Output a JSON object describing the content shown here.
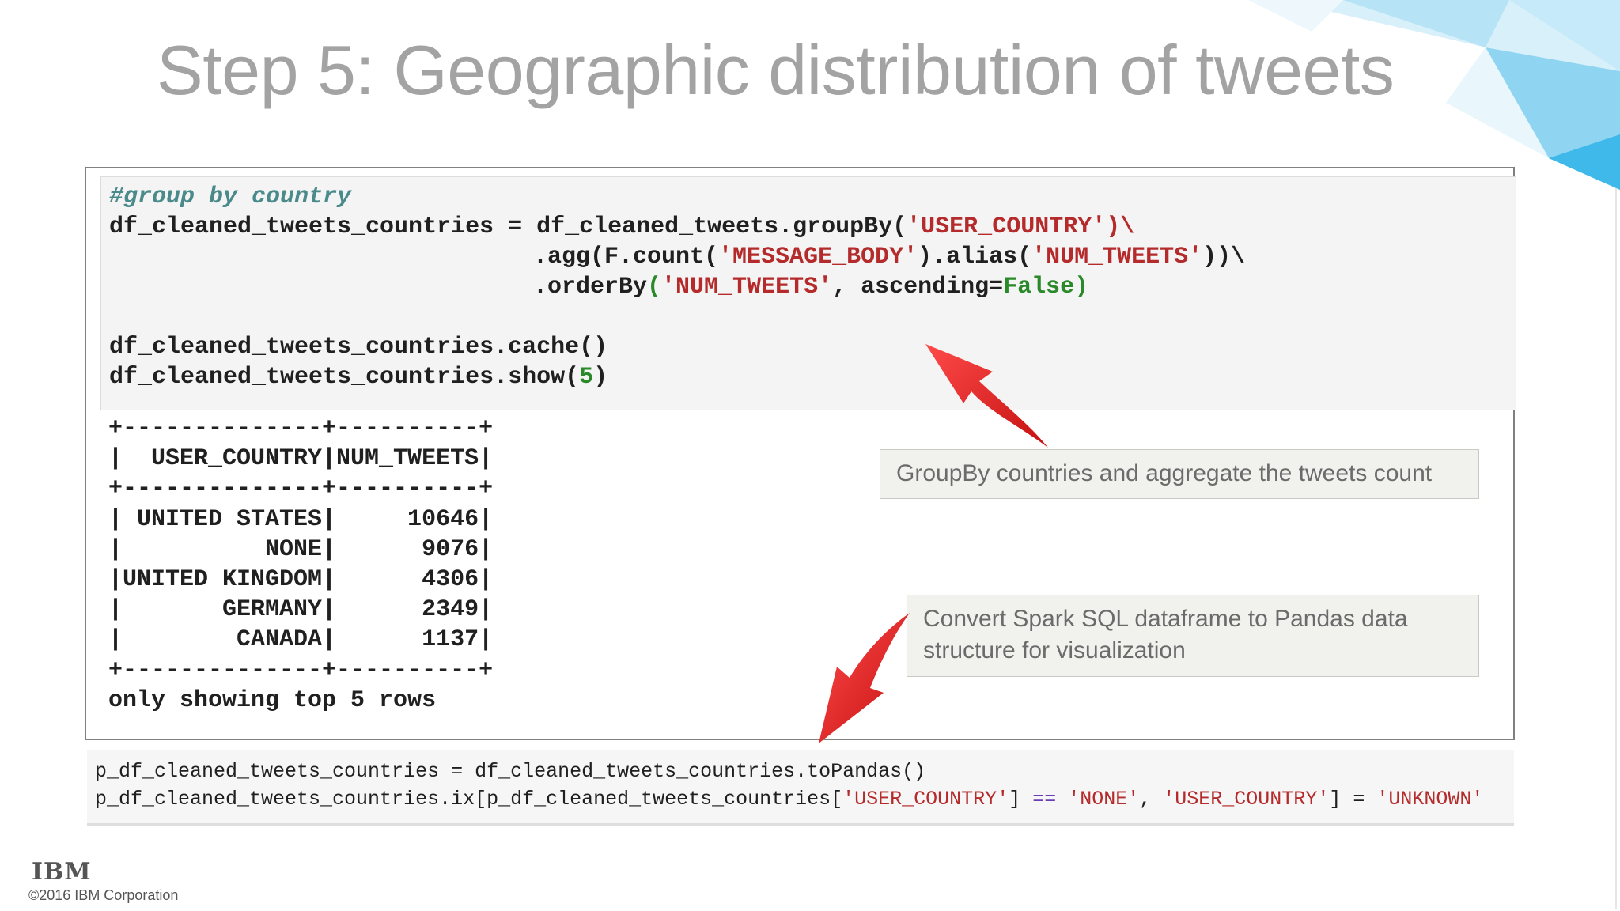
{
  "slide": {
    "title": "Step 5: Geographic distribution of tweets",
    "footer": {
      "logo_text": "IBM",
      "copyright": "©2016 IBM Corporation"
    }
  },
  "code_cell": {
    "line1_comment": "#group by country",
    "line2_a": "df_cleaned_tweets_countries = df_cleaned_tweets.groupBy(",
    "line2_str": "'USER_COUNTRY'",
    "line2_b": ")\\",
    "line3_a": ".agg(F.count(",
    "line3_str1": "'MESSAGE_BODY'",
    "line3_b": ").alias(",
    "line3_str2": "'NUM_TWEETS'",
    "line3_c": "))\\",
    "line4_a": ".orderBy",
    "line4_paren_open": "(",
    "line4_str": "'NUM_TWEETS'",
    "line4_b": ", ascending=",
    "line4_kw": "False",
    "line4_paren_close": ")",
    "line6": "df_cleaned_tweets_countries.cache()",
    "line7_a": "df_cleaned_tweets_countries.show(",
    "line7_num": "5",
    "line7_b": ")"
  },
  "output": {
    "lines": [
      "+--------------+----------+",
      "|  USER_COUNTRY|NUM_TWEETS|",
      "+--------------+----------+",
      "| UNITED STATES|     10646|",
      "|          NONE|      9076|",
      "|UNITED KINGDOM|      4306|",
      "|       GERMANY|      2349|",
      "|        CANADA|      1137|",
      "+--------------+----------+",
      "only showing top 5 rows"
    ]
  },
  "callouts": {
    "groupby": "GroupBy countries and aggregate the tweets count",
    "convert_line1": "Convert Spark SQL dataframe to Pandas data",
    "convert_line2": "structure for visualization"
  },
  "code_cell2": {
    "line1": "p_df_cleaned_tweets_countries = df_cleaned_tweets_countries.toPandas()",
    "line2_a": "p_df_cleaned_tweets_countries.ix[p_df_cleaned_tweets_countries[",
    "line2_str1": "'USER_COUNTRY'",
    "line2_b": "] ",
    "line2_op": "==",
    "line2_c": " ",
    "line2_str2": "'NONE'",
    "line2_d": ", ",
    "line2_str3": "'USER_COUNTRY'",
    "line2_e": "] = ",
    "line2_str4": "'UNKNOWN'"
  },
  "colors": {
    "title": "#a3a3a3",
    "string": "#b52b2b",
    "keyword": "#2a8a2a",
    "comment": "#4a8a8a",
    "arrow": "#e02020"
  }
}
